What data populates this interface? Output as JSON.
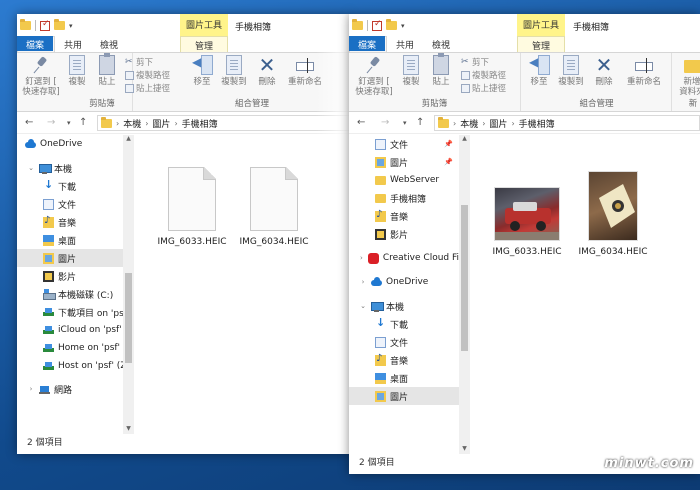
{
  "left": {
    "title": "手機相簿",
    "tools_tab": "圖片工具",
    "tabs": [
      "檔案",
      "常用",
      "共用",
      "檢視",
      "管理"
    ],
    "ribbon": {
      "pin": "釘選到 [",
      "pin2": "快速存取]",
      "copy": "複製",
      "paste": "貼上",
      "cut": "剪下",
      "copy_path": "複製路徑",
      "paste_shortcut": "貼上捷徑",
      "clipboard_label": "剪貼簿",
      "move_to": "移至",
      "copy_to": "複製到",
      "delete": "刪除",
      "rename": "重新命名",
      "organize_label": "組合管理"
    },
    "breadcrumb": [
      "本機",
      "圖片",
      "手機相簿"
    ],
    "nav": [
      {
        "label": "OneDrive",
        "icon": "cloud"
      },
      {
        "label": "本機",
        "icon": "pc"
      },
      {
        "label": "下載",
        "icon": "dl"
      },
      {
        "label": "文件",
        "icon": "doc"
      },
      {
        "label": "音樂",
        "icon": "music"
      },
      {
        "label": "桌面",
        "icon": "desk"
      },
      {
        "label": "圖片",
        "icon": "pic"
      },
      {
        "label": "影片",
        "icon": "vid"
      },
      {
        "label": "本機磁碟 (C:)",
        "icon": "drive"
      },
      {
        "label": "下載項目 on 'psf",
        "icon": "net"
      },
      {
        "label": "iCloud on 'psf' (",
        "icon": "net"
      },
      {
        "label": "Home on 'psf' ('",
        "icon": "net"
      },
      {
        "label": "Host on 'psf' (Z:",
        "icon": "net"
      },
      {
        "label": "網路",
        "icon": "netw"
      }
    ],
    "files": [
      "IMG_6033.HEIC",
      "IMG_6034.HEIC"
    ],
    "status": "2 個項目"
  },
  "right": {
    "title": "手機相簿",
    "tools_tab": "圖片工具",
    "tabs": [
      "檔案",
      "常用",
      "共用",
      "檢視",
      "管理"
    ],
    "ribbon": {
      "pin": "釘選到 [",
      "pin2": "快速存取]",
      "copy": "複製",
      "paste": "貼上",
      "cut": "剪下",
      "copy_path": "複製路徑",
      "paste_shortcut": "貼上捷徑",
      "clipboard_label": "剪貼簿",
      "move_to": "移至",
      "copy_to": "複製到",
      "delete": "刪除",
      "rename": "重新命名",
      "organize_label": "組合管理",
      "new_folder": "新增",
      "new_folder2": "資料夾",
      "new_label": "新"
    },
    "breadcrumb": [
      "本機",
      "圖片",
      "手機相簿"
    ],
    "nav": [
      {
        "label": "文件",
        "icon": "doc",
        "pinned": true
      },
      {
        "label": "圖片",
        "icon": "pic",
        "pinned": true
      },
      {
        "label": "WebServer",
        "icon": "folder"
      },
      {
        "label": "手機相簿",
        "icon": "folder"
      },
      {
        "label": "音樂",
        "icon": "music"
      },
      {
        "label": "影片",
        "icon": "vid"
      },
      {
        "label": "Creative Cloud Fi",
        "icon": "cc"
      },
      {
        "label": "OneDrive",
        "icon": "cloud"
      },
      {
        "label": "本機",
        "icon": "pc"
      },
      {
        "label": "下載",
        "icon": "dl"
      },
      {
        "label": "文件",
        "icon": "doc"
      },
      {
        "label": "音樂",
        "icon": "music"
      },
      {
        "label": "桌面",
        "icon": "desk"
      },
      {
        "label": "圖片",
        "icon": "pic"
      }
    ],
    "files": [
      "IMG_6033.HEIC",
      "IMG_6034.HEIC"
    ],
    "status": "2 個項目"
  },
  "watermark": "minwt.com"
}
